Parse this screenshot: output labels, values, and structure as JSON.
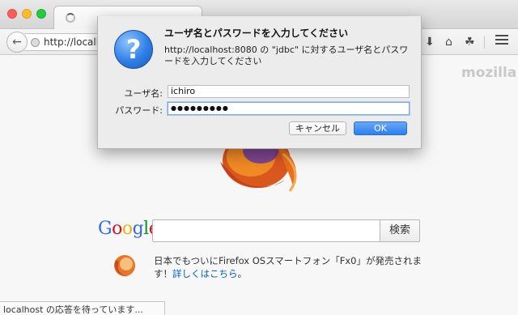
{
  "browser": {
    "url": "http://localhost",
    "brand": "mozilla"
  },
  "dialog": {
    "title": "ユーザ名とパスワードを入力してください",
    "message": "http://localhost:8080 の \"jdbc\" に対するユーザ名とパスワードを入力してください",
    "username_label": "ユーザ名:",
    "username_value": "ichiro",
    "password_label": "パスワード:",
    "password_value": "●●●●●●●●●",
    "cancel_label": "キャンセル",
    "ok_label": "OK"
  },
  "search": {
    "logo": "Google",
    "button_label": "検索"
  },
  "snippet": {
    "text": "日本でもついにFirefox OSスマートフォン「Fx0」が発売されます！",
    "link": "詳しくはこちら",
    "after": "。"
  },
  "status": {
    "text": "localhost の応答を待っています..."
  },
  "colors": {
    "accent": "#2a7ff0",
    "google_blue": "#3369e8",
    "google_red": "#d50f25",
    "google_yellow": "#eeb211",
    "google_green": "#009925"
  },
  "icons": [
    "back-arrow-icon",
    "globe-icon",
    "download-icon",
    "home-icon",
    "share-icon",
    "hamburger-menu-icon",
    "question-icon",
    "loading-spinner-icon"
  ]
}
